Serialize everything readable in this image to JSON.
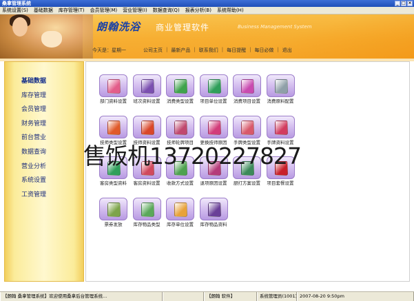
{
  "window": {
    "title": "桑拿管理系统"
  },
  "menu": [
    "系统设置(S)",
    "基础数据",
    "库存管理(T)",
    "会员管理(M)",
    "营业管理(I)",
    "数据查询(Q)",
    "报表分析(B)",
    "系统帮助(H)"
  ],
  "banner": {
    "brand": "朗翰洗浴",
    "subtitle": "商业管理软件",
    "english": "Business Management System",
    "date": "今天是：星期一"
  },
  "topnav": [
    "公司主页",
    "最新产品",
    "联系我们",
    "每日提醒",
    "每日必做",
    "退出"
  ],
  "sidebar": [
    "基础数据",
    "库存管理",
    "会员管理",
    "财务管理",
    "前台营业",
    "数据查询",
    "营业分析",
    "系统设置",
    "工资管理"
  ],
  "tiles": [
    {
      "label": "部门资料设置",
      "color": "#e35d8a"
    },
    {
      "label": "班次资料设置",
      "color": "#7b4fb0"
    },
    {
      "label": "消费类型设置",
      "color": "#3fa34d"
    },
    {
      "label": "项目单位设置",
      "color": "#2f9f5a"
    },
    {
      "label": "消费项目设置",
      "color": "#c94ab0"
    },
    {
      "label": "消费原料配置",
      "color": "#8fa0a8"
    },
    {
      "label": "技师类型设置",
      "color": "#e05a2a"
    },
    {
      "label": "技师资料设置",
      "color": "#d9472a"
    },
    {
      "label": "技师轮牌项目",
      "color": "#c0486f"
    },
    {
      "label": "更换技师原因",
      "color": "#d23c7a"
    },
    {
      "label": "手牌类型设置",
      "color": "#d8596b"
    },
    {
      "label": "手牌资料设置",
      "color": "#d23c60"
    },
    {
      "label": "客房类型资料",
      "color": "#2f9f5a"
    },
    {
      "label": "客房资料设置",
      "color": "#d1495d"
    },
    {
      "label": "收款方式设置",
      "color": "#4ea24f"
    },
    {
      "label": "退项原因设置",
      "color": "#b53b7a"
    },
    {
      "label": "厨打方案设置",
      "color": "#3c8a5a"
    },
    {
      "label": "项目套餐设置",
      "color": "#c8202a"
    },
    {
      "label": "票券发放",
      "color": "#7da44a"
    },
    {
      "label": "库存物品类型",
      "color": "#5aa85a"
    },
    {
      "label": "库存单位设置",
      "color": "#e8a23a"
    },
    {
      "label": "库存物品资料",
      "color": "#6a3f98"
    }
  ],
  "watermark": "售饭机13720227827",
  "status": [
    "【朗翰 桑拿管理系统】欢迎使用桑拿后台管理系统...",
    "",
    "【朗翰 软件】",
    "系统管理员(1001)",
    "2007-08-20 9:50pm"
  ]
}
